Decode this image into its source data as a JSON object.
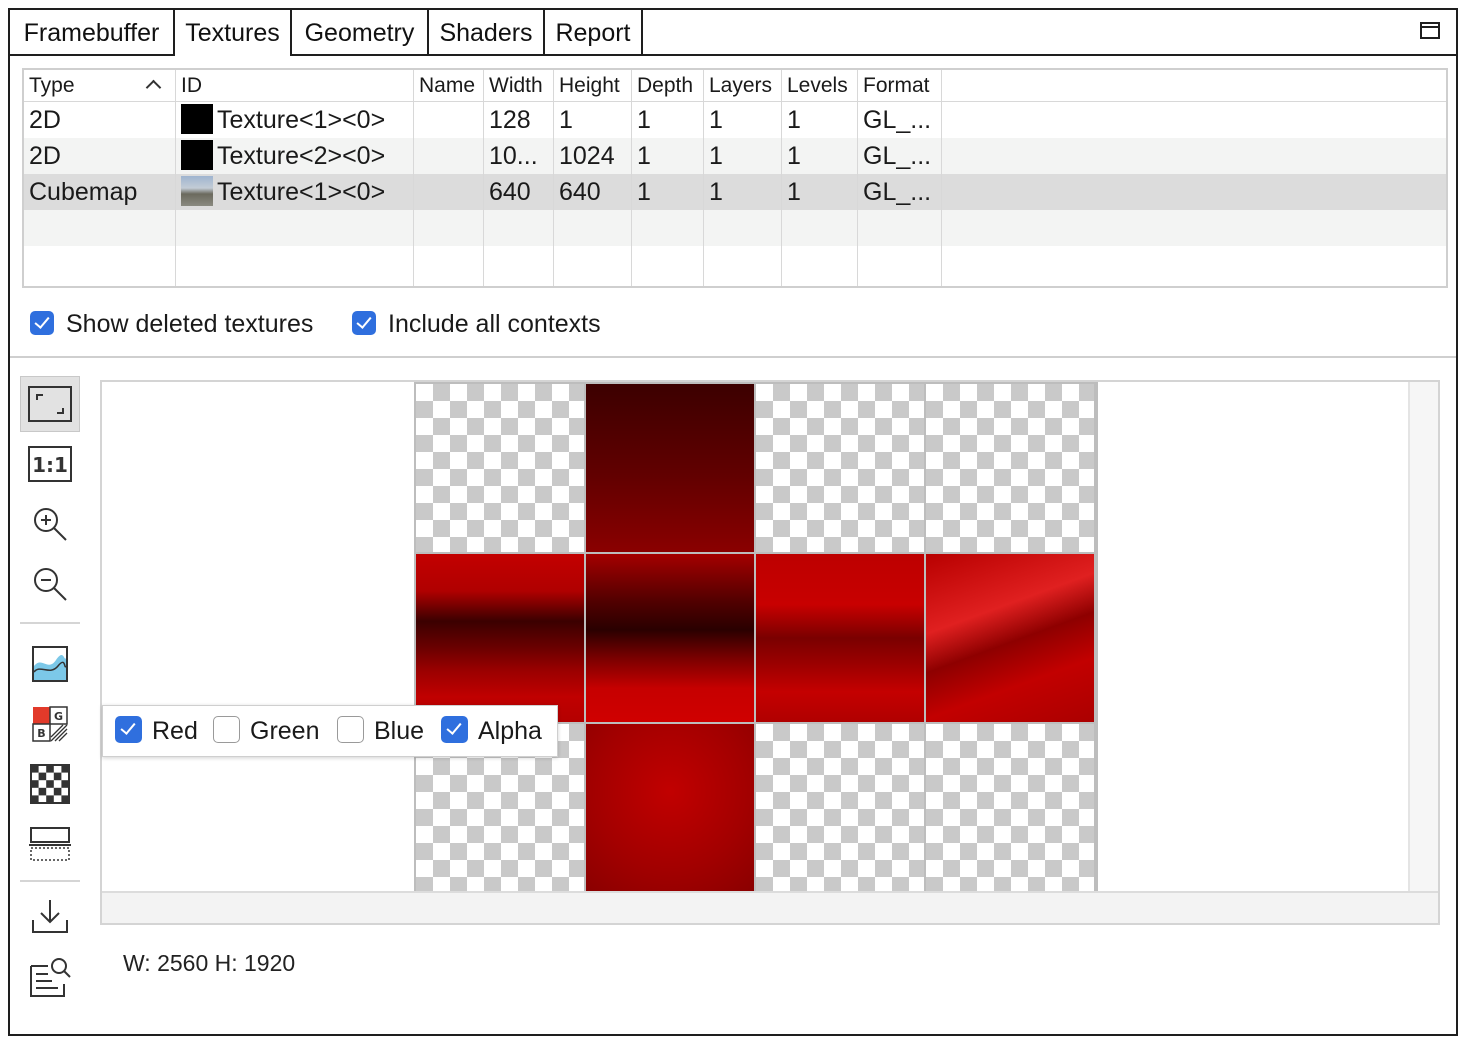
{
  "tabs": [
    {
      "label": "Framebuffer",
      "active": false
    },
    {
      "label": "Textures",
      "active": true
    },
    {
      "label": "Geometry",
      "active": false
    },
    {
      "label": "Shaders",
      "active": false
    },
    {
      "label": "Report",
      "active": false
    }
  ],
  "table": {
    "columns": [
      "Type",
      "ID",
      "Name",
      "Width",
      "Height",
      "Depth",
      "Layers",
      "Levels",
      "Format"
    ],
    "sort_column": "Type",
    "rows": [
      {
        "type": "2D",
        "id": "Texture<1><0>",
        "name": "",
        "width": "128",
        "height": "1",
        "depth": "1",
        "layers": "1",
        "levels": "1",
        "format": "GL_..."
      },
      {
        "type": "2D",
        "id": "Texture<2><0>",
        "name": "",
        "width": "10...",
        "height": "1024",
        "depth": "1",
        "layers": "1",
        "levels": "1",
        "format": "GL_..."
      },
      {
        "type": "Cubemap",
        "id": "Texture<1><0>",
        "name": "",
        "width": "640",
        "height": "640",
        "depth": "1",
        "layers": "1",
        "levels": "1",
        "format": "GL_..."
      }
    ],
    "selected_row": 2
  },
  "options": {
    "show_deleted": {
      "label": "Show deleted textures",
      "checked": true
    },
    "include_all_contexts": {
      "label": "Include all contexts",
      "checked": true
    }
  },
  "toolbar_icons": [
    "fit-to-window-icon",
    "actual-size-icon",
    "zoom-in-icon",
    "zoom-out-icon",
    "histogram-icon",
    "color-channels-icon",
    "checkerboard-icon",
    "flip-icon",
    "save-icon",
    "inspect-icon"
  ],
  "channels": [
    {
      "label": "Red",
      "checked": true
    },
    {
      "label": "Green",
      "checked": false
    },
    {
      "label": "Blue",
      "checked": false
    },
    {
      "label": "Alpha",
      "checked": true
    }
  ],
  "size_readout": "W: 2560 H: 1920",
  "colors": {
    "accent": "#2f6fde",
    "selected_row": "#dcdcdc"
  }
}
